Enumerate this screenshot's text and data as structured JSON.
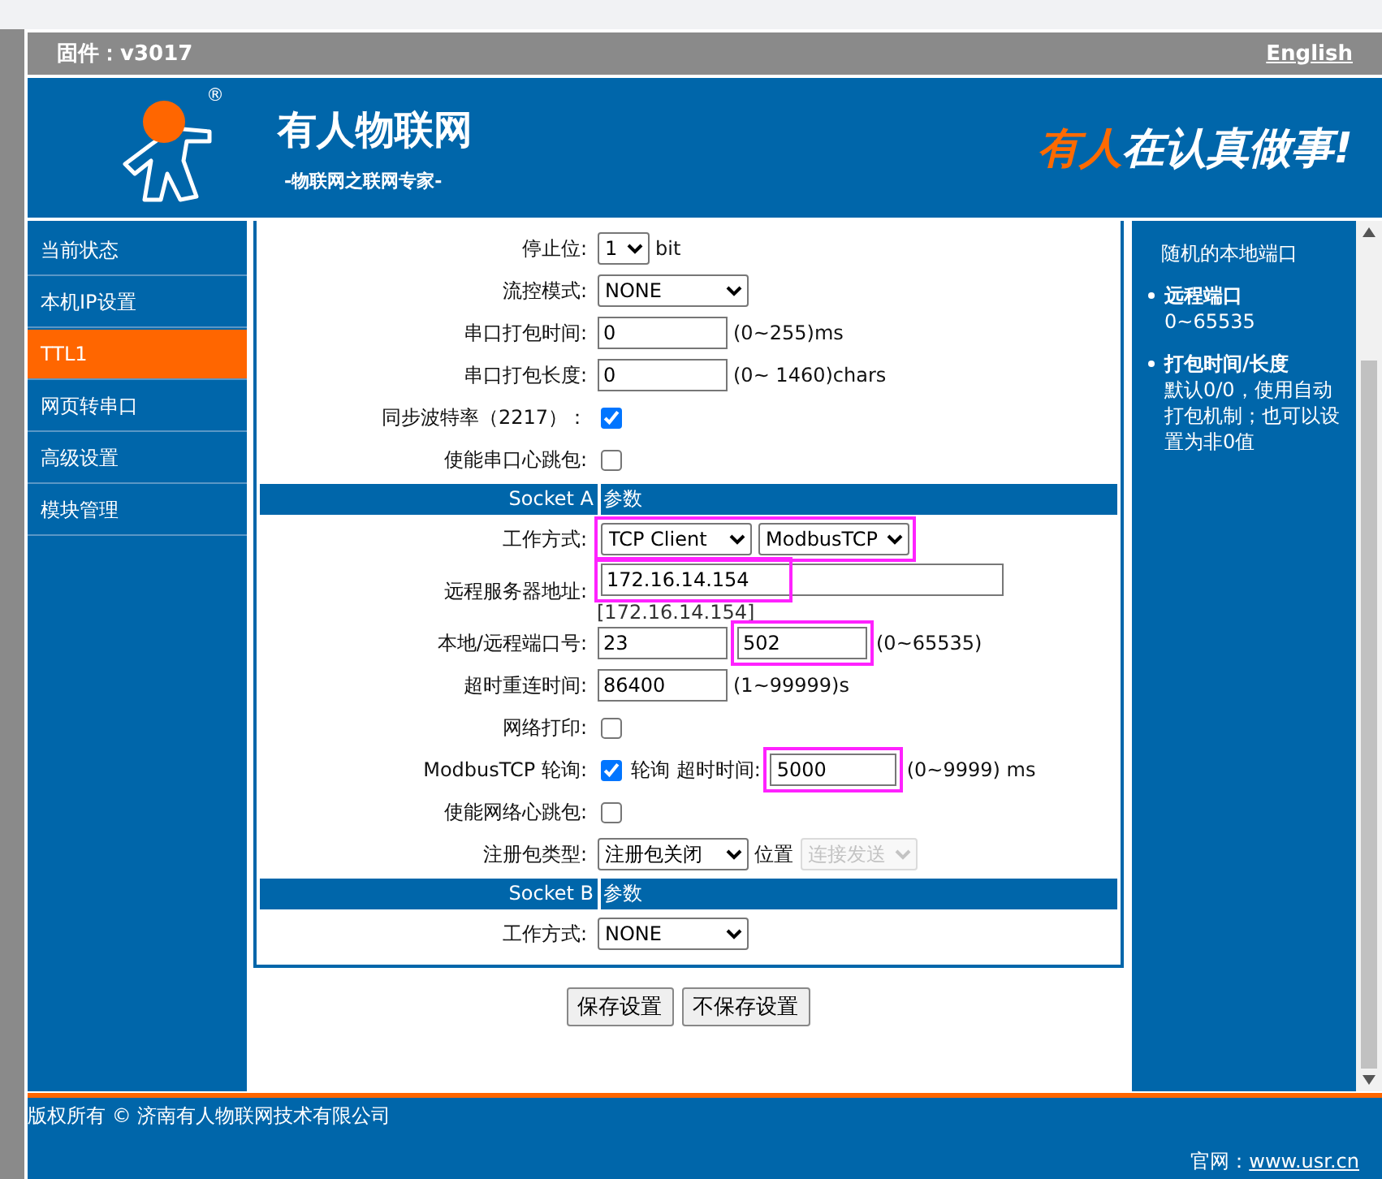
{
  "header": {
    "firmware": "固件：v3017",
    "language_link": "English"
  },
  "banner": {
    "logo_mark": "®",
    "brand": "有人物联网",
    "tagline": "-物联网之联网专家-",
    "slogan_highlight": "有人",
    "slogan": "在认真做事!"
  },
  "sidebar": {
    "items": [
      {
        "label": "当前状态",
        "selected": false
      },
      {
        "label": "本机IP设置",
        "selected": false
      },
      {
        "label": "TTL1",
        "selected": true
      },
      {
        "label": "网页转串口",
        "selected": false
      },
      {
        "label": "高级设置",
        "selected": false
      },
      {
        "label": "模块管理",
        "selected": false
      }
    ]
  },
  "form": {
    "rows": [
      {
        "kind": "field",
        "label": "停止位:",
        "controls": [
          {
            "kind": "select-narrow",
            "value": "1"
          },
          {
            "kind": "text",
            "text": "bit"
          }
        ]
      },
      {
        "kind": "field",
        "label": "流控模式:",
        "controls": [
          {
            "kind": "select",
            "value": "NONE"
          }
        ]
      },
      {
        "kind": "field",
        "label": "串口打包时间:",
        "controls": [
          {
            "kind": "input",
            "value": "0"
          },
          {
            "kind": "text",
            "text": "(0~255)ms"
          }
        ]
      },
      {
        "kind": "field",
        "label": "串口打包长度:",
        "controls": [
          {
            "kind": "input",
            "value": "0"
          },
          {
            "kind": "text",
            "text": "(0~ 1460)chars"
          }
        ]
      },
      {
        "kind": "field",
        "label": "同步波特率（2217）：",
        "controls": [
          {
            "kind": "checkbox",
            "checked": true
          }
        ]
      },
      {
        "kind": "field",
        "label": "使能串口心跳包:",
        "controls": [
          {
            "kind": "checkbox",
            "checked": false
          }
        ]
      },
      {
        "kind": "section",
        "title": "Socket A",
        "note": "参数"
      },
      {
        "kind": "field",
        "label": "工作方式:",
        "controls": [
          {
            "kind": "highlight",
            "controls": [
              {
                "kind": "select",
                "value": "TCP Client"
              },
              {
                "kind": "select",
                "value": "ModbusTCP"
              }
            ]
          }
        ]
      },
      {
        "kind": "field",
        "label": "远程服务器地址:",
        "controls": [
          {
            "kind": "highlight-partial",
            "controls": [
              {
                "kind": "input-wide",
                "value": "172.16.14.154"
              }
            ]
          }
        ],
        "hint": "[172.16.14.154]"
      },
      {
        "kind": "field",
        "label": "本地/远程端口号:",
        "controls": [
          {
            "kind": "input",
            "value": "23"
          },
          {
            "kind": "highlight",
            "controls": [
              {
                "kind": "input",
                "value": "502"
              }
            ]
          },
          {
            "kind": "text",
            "text": "(0~65535)"
          }
        ]
      },
      {
        "kind": "field",
        "label": "超时重连时间:",
        "controls": [
          {
            "kind": "input",
            "value": "86400"
          },
          {
            "kind": "text",
            "text": "(1~99999)s"
          }
        ]
      },
      {
        "kind": "field",
        "label": "网络打印:",
        "controls": [
          {
            "kind": "checkbox",
            "checked": false
          }
        ]
      },
      {
        "kind": "field",
        "label": "ModbusTCP 轮询:",
        "controls": [
          {
            "kind": "checkbox",
            "checked": true
          },
          {
            "kind": "text",
            "text": "轮询 超时时间:"
          },
          {
            "kind": "highlight",
            "controls": [
              {
                "kind": "input-short",
                "value": "5000"
              }
            ]
          },
          {
            "kind": "text",
            "text": "(0~9999) ms"
          }
        ]
      },
      {
        "kind": "field",
        "label": "使能网络心跳包:",
        "controls": [
          {
            "kind": "checkbox",
            "checked": false
          }
        ]
      },
      {
        "kind": "field",
        "label": "注册包类型:",
        "controls": [
          {
            "kind": "select",
            "value": "注册包关闭"
          },
          {
            "kind": "text",
            "text": "位置"
          },
          {
            "kind": "select-disabled",
            "value": "连接发送"
          }
        ]
      },
      {
        "kind": "section",
        "title": "Socket B",
        "note": "参数"
      },
      {
        "kind": "field",
        "label": "工作方式:",
        "controls": [
          {
            "kind": "select",
            "value": "NONE"
          }
        ]
      }
    ],
    "buttons": [
      "保存设置",
      "不保存设置"
    ]
  },
  "help": {
    "items": [
      {
        "kind": "continuation",
        "text": "随机的本地端口"
      },
      {
        "kind": "bullet",
        "title": "远程端口",
        "text": "0~65535"
      },
      {
        "kind": "bullet",
        "title": "打包时间/长度",
        "text": "默认0/0，使用自动打包机制；也可以设置为非0值"
      }
    ]
  },
  "footer": {
    "copyright": "版权所有 © 济南有人物联网技术有限公司",
    "site_label": "官网：",
    "site_link": "www.usr.cn"
  }
}
